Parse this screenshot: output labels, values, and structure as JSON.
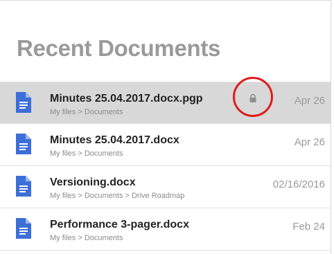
{
  "header": {
    "title": "Recent Documents"
  },
  "colors": {
    "doc_icon": "#3d6fd9",
    "selected_row": "#d8d8d8",
    "highlight_ring": "#e11a1a"
  },
  "documents": [
    {
      "name": "Minutes 25.04.2017.docx.pgp",
      "path": "My files > Documents",
      "date": "Apr 26",
      "icon": "document-icon",
      "locked": true,
      "selected": true
    },
    {
      "name": "Minutes 25.04.2017.docx",
      "path": "My files > Documents",
      "date": "Apr 26",
      "icon": "document-icon",
      "locked": false,
      "selected": false
    },
    {
      "name": "Versioning.docx",
      "path": "My files > Documents > Drive Roadmap",
      "date": "02/16/2016",
      "icon": "document-icon",
      "locked": false,
      "selected": false
    },
    {
      "name": "Performance 3-pager.docx",
      "path": "My files > Documents",
      "date": "Feb 24",
      "icon": "document-icon",
      "locked": false,
      "selected": false
    }
  ]
}
